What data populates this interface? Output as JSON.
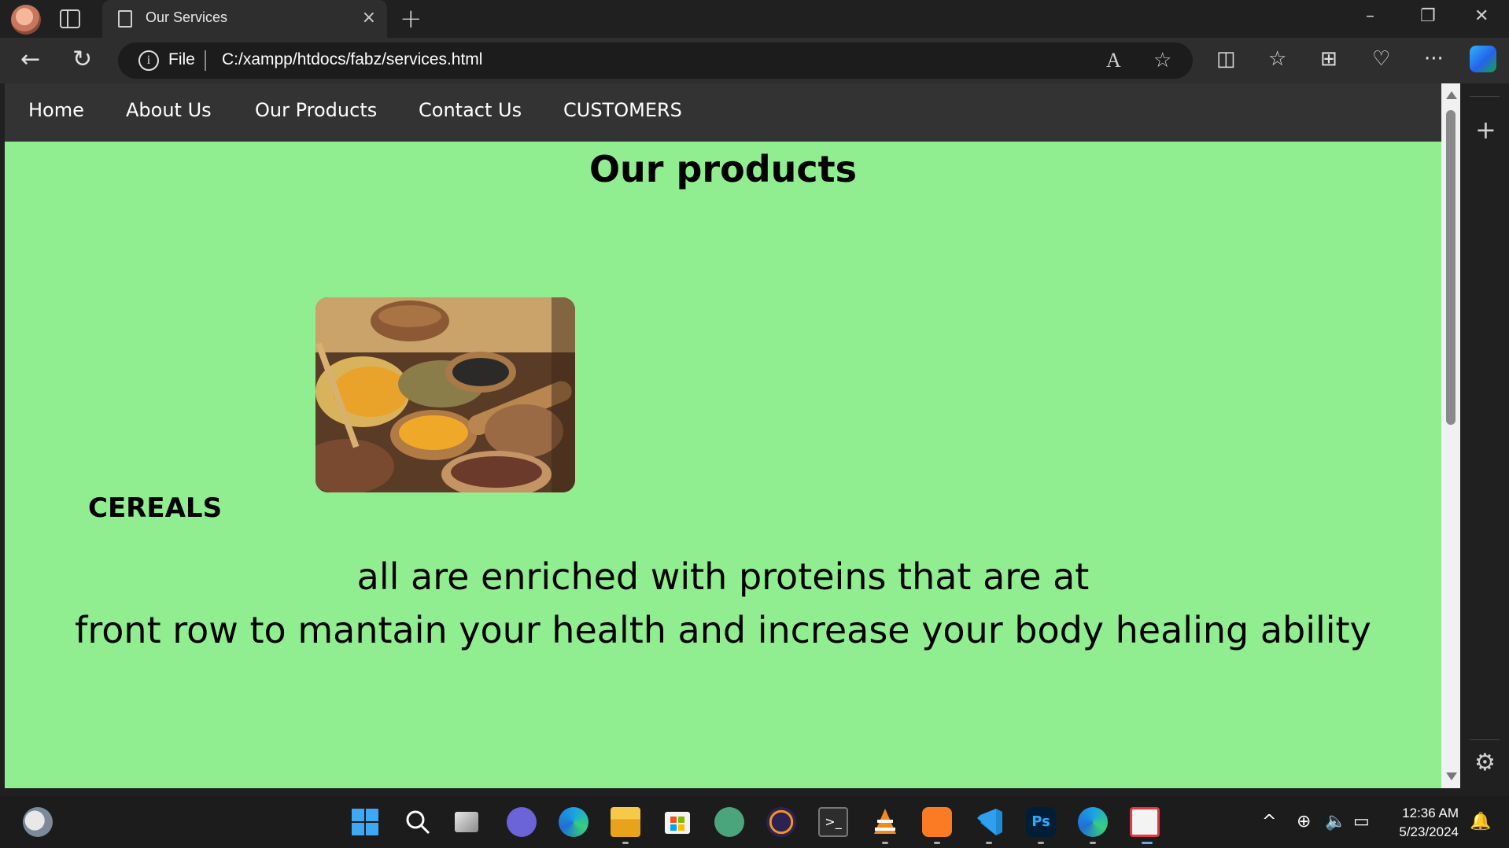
{
  "browser": {
    "tab_title": "Our Services",
    "tab_close": "×",
    "new_tab": "+",
    "address_scheme": "File",
    "address_url": "C:/xampp/htdocs/fabz/services.html",
    "info_glyph": "i",
    "window_controls": {
      "minimize": "–",
      "restore": "❐",
      "close": "✕"
    },
    "nav": {
      "back": "←",
      "refresh": "↻"
    },
    "toolbar_icons": {
      "read_aloud": "A",
      "favorite": "☆",
      "split": "◫",
      "favorites_list": "☆",
      "collections": "⊞",
      "health": "♡",
      "more": "···"
    },
    "sidebar": {
      "add": "+",
      "settings": "⚙"
    }
  },
  "site": {
    "nav": [
      "Home",
      "About Us",
      "Our Products",
      "Contact Us",
      "CUSTOMERS"
    ],
    "page_title": "Our products",
    "product_label": "CEREALS",
    "description_line1": "all are enriched with proteins that are at",
    "description_line2": "front row to mantain your health and increase your body healing ability",
    "colors": {
      "page_bg": "#90ee90",
      "nav_bg": "#333333"
    }
  },
  "taskbar": {
    "apps": [
      "weather-icon",
      "windows-start-icon",
      "search-icon",
      "task-view-icon",
      "teams-icon",
      "edge-icon",
      "file-explorer-icon",
      "store-icon",
      "chatgpt-icon",
      "eclipse-icon",
      "terminal-icon",
      "vlc-icon",
      "xampp-icon",
      "vscode-icon",
      "photoshop-icon",
      "edge-dev-icon",
      "snipping-tool-icon"
    ],
    "photoshop_label": "Ps",
    "clock_time": "12:36 AM",
    "clock_date": "5/23/2024"
  }
}
